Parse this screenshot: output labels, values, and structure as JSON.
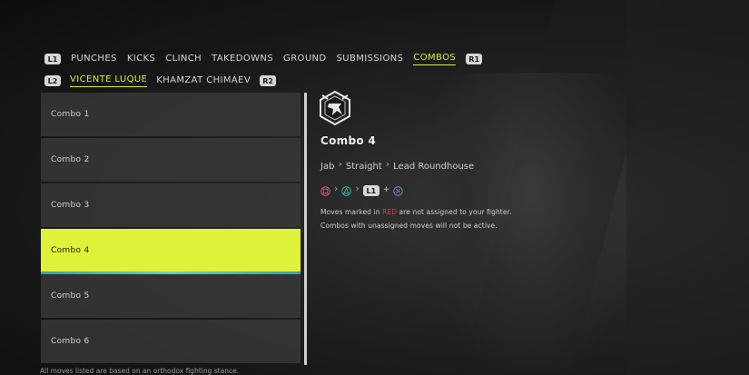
{
  "top_tabs": {
    "left_badge": "L1",
    "right_badge": "R1",
    "items": [
      "PUNCHES",
      "KICKS",
      "CLINCH",
      "TAKEDOWNS",
      "GROUND",
      "SUBMISSIONS",
      "COMBOS"
    ],
    "active": "COMBOS"
  },
  "fighter_tabs": {
    "left_badge": "L2",
    "right_badge": "R2",
    "items": [
      "VICENTE LUQUE",
      "KHAMZAT CHIMAEV"
    ],
    "active": "VICENTE LUQUE"
  },
  "combo_list": {
    "items": [
      "Combo 1",
      "Combo 2",
      "Combo 3",
      "Combo 4",
      "Combo 5",
      "Combo 6"
    ],
    "selected": "Combo 4"
  },
  "detail": {
    "title": "Combo 4",
    "sequence": [
      "Jab",
      "Straight",
      "Lead Roundhouse"
    ],
    "inputs": {
      "first": "square-button-icon",
      "second": "triangle-button-icon",
      "modifier": "L1",
      "plus": "+",
      "last": "cross-button-icon"
    },
    "note1_pre": "Moves marked in ",
    "note1_red": "RED",
    "note1_post": " are not assigned to your fighter.",
    "note2": "Combos with unassigned moves will not be active."
  },
  "footer": "All moves listed are based on an orthodox fighting stance.",
  "colors": {
    "accent": "#dff23a",
    "accent_text": "#d6f03d",
    "teal_underline": "#5cd6c8",
    "warning_red": "#e23b3b",
    "playstation_pink": "#d45a9a",
    "playstation_teal": "#3fb3a8",
    "playstation_blue": "#6d8fd6"
  }
}
